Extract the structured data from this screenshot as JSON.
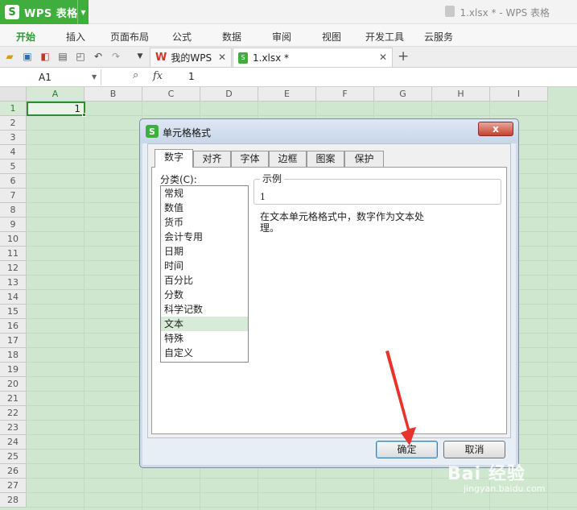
{
  "app": {
    "logo": "S",
    "name": "WPS 表格",
    "window_title": "1.xlsx * - WPS 表格"
  },
  "menu": {
    "items": [
      "开始",
      "插入",
      "页面布局",
      "公式",
      "数据",
      "审阅",
      "视图",
      "开发工具",
      "云服务"
    ],
    "active": "开始"
  },
  "tabs": [
    {
      "label": "我的WPS",
      "icon": "wps-logo-icon"
    },
    {
      "label": "1.xlsx *",
      "icon": "xlsx-file-icon"
    }
  ],
  "formula_bar": {
    "name_box": "A1",
    "fx": "fx",
    "value": "1"
  },
  "sheet": {
    "columns": [
      "A",
      "B",
      "C",
      "D",
      "E",
      "F",
      "G",
      "H",
      "I"
    ],
    "rows": [
      "1",
      "2",
      "3",
      "4",
      "5",
      "6",
      "7",
      "8",
      "9",
      "10",
      "11",
      "12",
      "13",
      "14",
      "15",
      "16",
      "17",
      "18",
      "19",
      "20",
      "21",
      "22",
      "23",
      "24",
      "25",
      "26",
      "27",
      "28"
    ],
    "active_cell": "A1",
    "active_value": "1",
    "selection_color": "#2f8d2f",
    "grid_color": "#cfe7cf"
  },
  "dialog": {
    "icon": "S",
    "title": "单元格格式",
    "close_label": "x",
    "tabs": [
      "数字",
      "对齐",
      "字体",
      "边框",
      "图案",
      "保护"
    ],
    "active_tab": "数字",
    "category_label": "分类(C):",
    "categories": [
      "常规",
      "数值",
      "货币",
      "会计专用",
      "日期",
      "时间",
      "百分比",
      "分数",
      "科学记数",
      "文本",
      "特殊",
      "自定义"
    ],
    "selected_category": "文本",
    "sample_label": "示例",
    "sample_value": "1",
    "description": "在文本单元格格式中，数字作为文本处理。",
    "ok_label": "确定",
    "cancel_label": "取消"
  },
  "watermark": {
    "main": "Bai 经验",
    "sub": "jingyan.baidu.com"
  }
}
